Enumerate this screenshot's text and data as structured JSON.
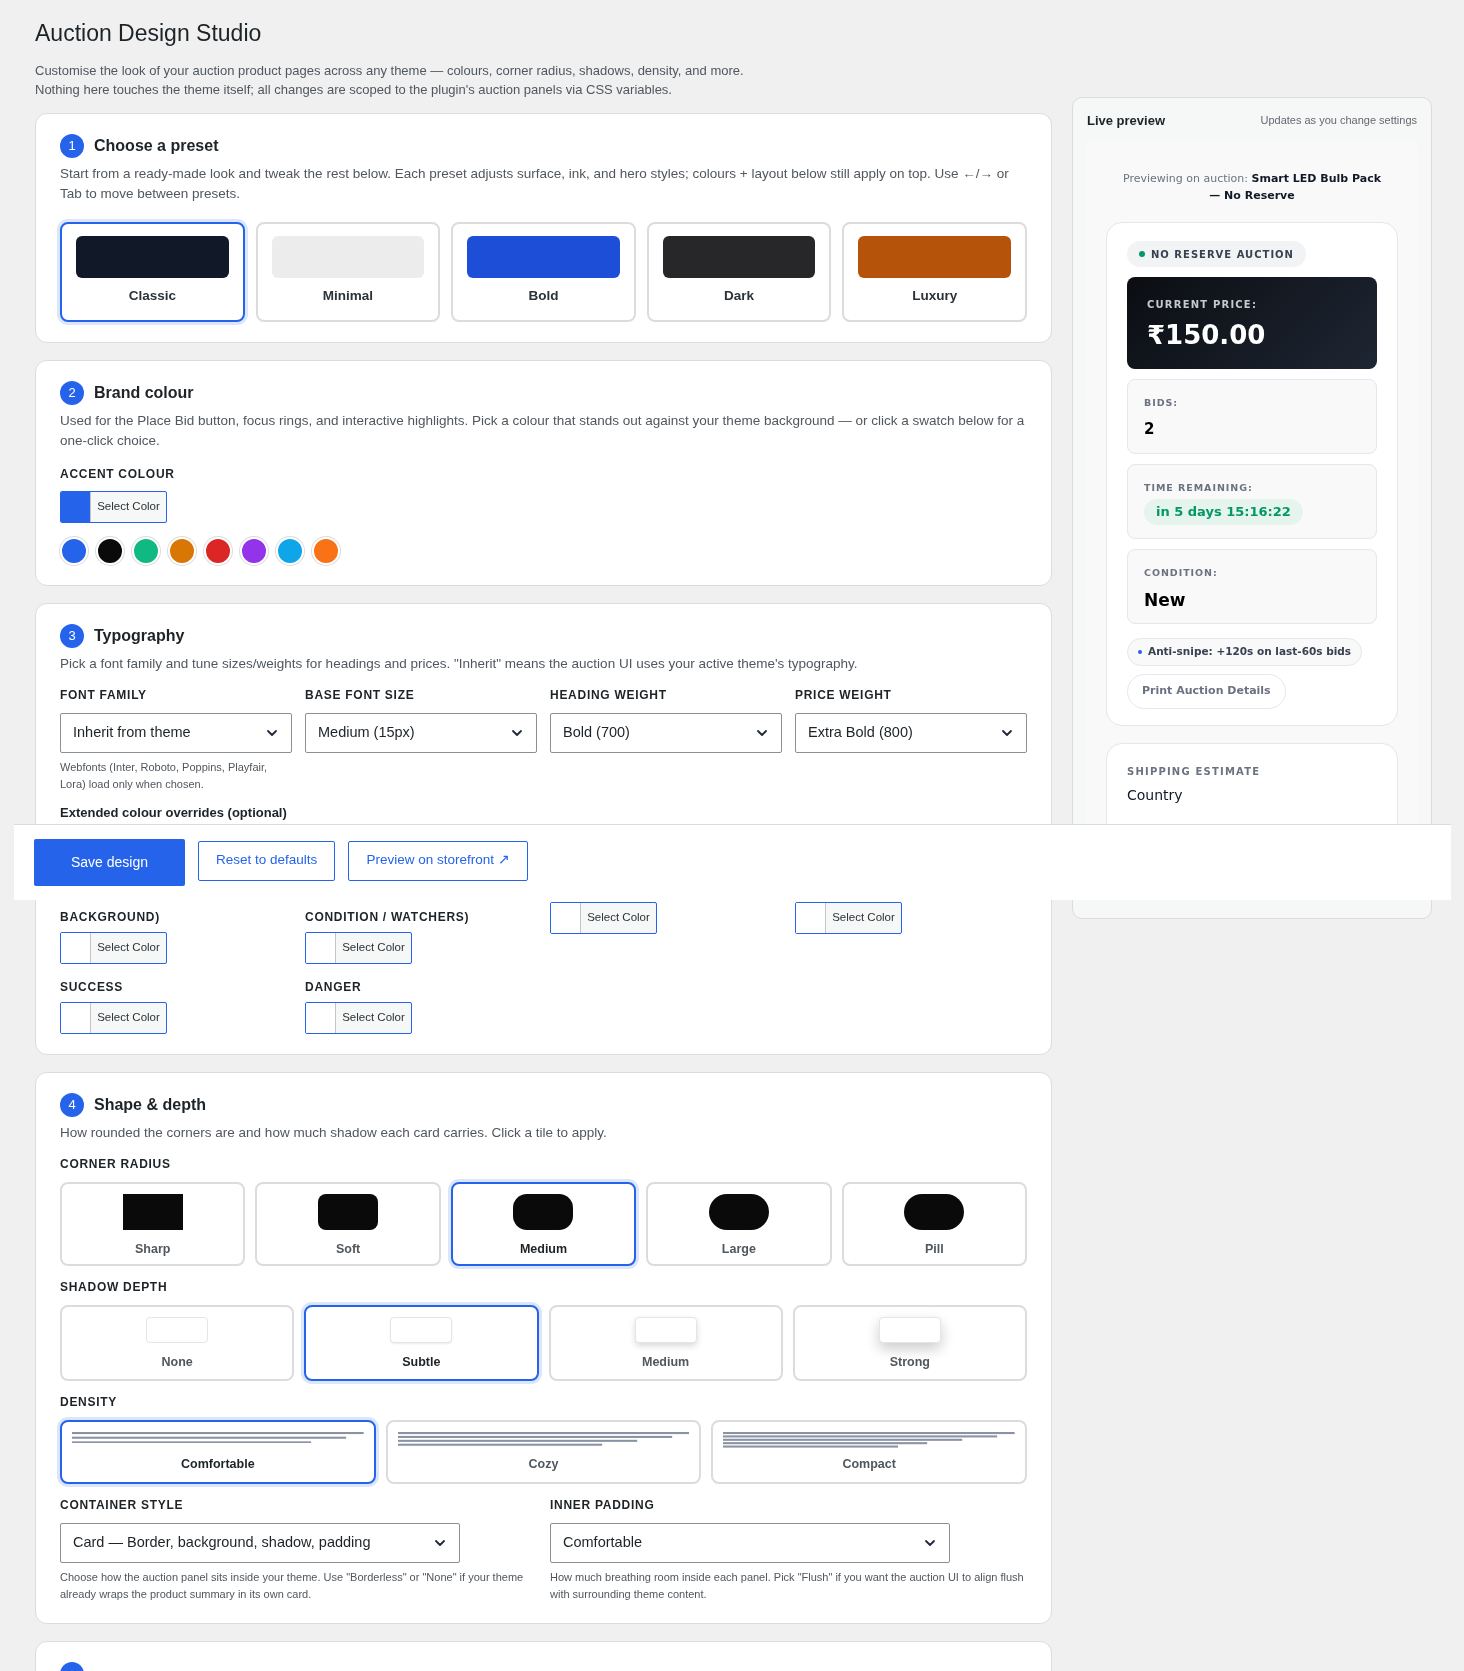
{
  "page": {
    "title": "Auction Design Studio",
    "description": [
      "Customise the look of your auction product pages across any theme — colours, corner radius, shadows, density, and more.",
      "Nothing here touches the theme itself; all changes are scoped to the plugin's auction panels via CSS variables."
    ]
  },
  "preset_section": {
    "number": "1",
    "title": "Choose a preset",
    "description": "Start from a ready-made look and tweak the rest below. Each preset adjusts surface, ink, and hero styles; colours + layout below still apply on top. Use ←/→ or Tab to move between presets.",
    "presets": [
      {
        "label": "Classic",
        "color": "#111827",
        "selected": true
      },
      {
        "label": "Minimal",
        "color": "#ececec",
        "selected": false
      },
      {
        "label": "Bold",
        "color": "#1d4ed8",
        "selected": false
      },
      {
        "label": "Dark",
        "color": "#27272a",
        "selected": false
      },
      {
        "label": "Luxury",
        "color": "#b45309",
        "selected": false
      }
    ]
  },
  "brand_section": {
    "number": "2",
    "title": "Brand colour",
    "description": "Used for the Place Bid button, focus rings, and interactive highlights. Pick a colour that stands out against your theme background — or click a swatch below for a one-click choice.",
    "accent_label": "ACCENT COLOUR",
    "accent_picker": {
      "label": "Select Color",
      "color": "#2563eb"
    },
    "swatches": [
      {
        "color": "#2563eb"
      },
      {
        "color": "#0a0a0a"
      },
      {
        "color": "#10b981"
      },
      {
        "color": "#d97706"
      },
      {
        "color": "#dc2626"
      },
      {
        "color": "#9333ea"
      },
      {
        "color": "#0ea5e9"
      },
      {
        "color": "#f97316"
      }
    ]
  },
  "typography_section": {
    "number": "3",
    "title": "Typography",
    "description": "Pick a font family and tune sizes/weights for headings and prices. \"Inherit\" means the auction UI uses your active theme's typography.",
    "selects": [
      {
        "label": "FONT FAMILY",
        "value": "Inherit from theme",
        "hint": "Webfonts (Inter, Roboto, Poppins, Playfair, Lora) load only when chosen."
      },
      {
        "label": "BASE FONT SIZE",
        "value": "Medium (15px)"
      },
      {
        "label": "HEADING WEIGHT",
        "value": "Bold (700)"
      },
      {
        "label": "PRICE WEIGHT",
        "value": "Extra Bold (800)"
      }
    ],
    "overrides_title": "Extended colour overrides (optional)",
    "override_pickers": [
      {
        "label": "BACKGROUND)",
        "button": "Select Color"
      },
      {
        "label": "CONDITION / WATCHERS)",
        "button": "Select Color"
      },
      {
        "button": "Select Color"
      },
      {
        "button": "Select Color"
      },
      {
        "label": "SUCCESS",
        "button": "Select Color"
      },
      {
        "label": "DANGER",
        "button": "Select Color"
      }
    ]
  },
  "action_bar": {
    "buttons": [
      {
        "label": "Save design",
        "kind": "primary"
      },
      {
        "label": "Reset to defaults",
        "kind": "outline"
      },
      {
        "label": "Preview on storefront ↗",
        "kind": "outline"
      }
    ]
  },
  "shape_section": {
    "number": "4",
    "title": "Shape & depth",
    "description": "How rounded the corners are and how much shadow each card carries. Click a tile to apply.",
    "corner_label": "CORNER RADIUS",
    "corners": [
      {
        "label": "Sharp",
        "kind": "sharp",
        "selected": false
      },
      {
        "label": "Soft",
        "kind": "soft",
        "selected": false
      },
      {
        "label": "Medium",
        "kind": "medium",
        "selected": true
      },
      {
        "label": "Large",
        "kind": "large",
        "selected": false
      },
      {
        "label": "Pill",
        "kind": "pill",
        "selected": false
      }
    ],
    "shadow_label": "SHADOW DEPTH",
    "shadows": [
      {
        "label": "None",
        "kind": "none",
        "selected": false
      },
      {
        "label": "Subtle",
        "kind": "subtle",
        "selected": true
      },
      {
        "label": "Medium",
        "kind": "medium",
        "selected": false
      },
      {
        "label": "Strong",
        "kind": "strong",
        "selected": false
      }
    ],
    "density_label": "DENSITY",
    "densities": [
      {
        "label": "Comfortable",
        "kind": "comfortable",
        "selected": true
      },
      {
        "label": "Cozy",
        "kind": "cozy",
        "selected": false
      },
      {
        "label": "Compact",
        "kind": "compact",
        "selected": false
      }
    ],
    "selects": [
      {
        "label": "CONTAINER STYLE",
        "value": "Card — Border, background, shadow, padding",
        "hint": "Choose how the auction panel sits inside your theme. Use \"Borderless\" or \"None\" if your theme already wraps the product summary in its own card."
      },
      {
        "label": "INNER PADDING",
        "value": "Comfortable",
        "hint": "How much breathing room inside each panel. Pick \"Flush\" if you want the auction UI to align flush with surrounding theme content."
      }
    ]
  },
  "preview": {
    "title": "Live preview",
    "note": "Updates as you change settings",
    "auction": "Previewing on auction: **Smart LED Bulb Pack — No Reserve**",
    "badge": "NO RESERVE AUCTION",
    "price_label": "CURRENT PRICE:",
    "price": "₹150.00",
    "stats": [
      {
        "label": "BIDS:",
        "value": "2",
        "kind": "plain"
      },
      {
        "label": "TIME REMAINING:",
        "value": "in 5 days 15:16:22",
        "kind": "pill"
      },
      {
        "label": "CONDITION:",
        "value": "New",
        "kind": "large"
      }
    ],
    "anti_snipe": "Anti-snipe: +120s on last-60s bids",
    "print_button": "Print Auction Details",
    "shipping_label": "SHIPPING ESTIMATE",
    "shipping_field": "Country"
  }
}
